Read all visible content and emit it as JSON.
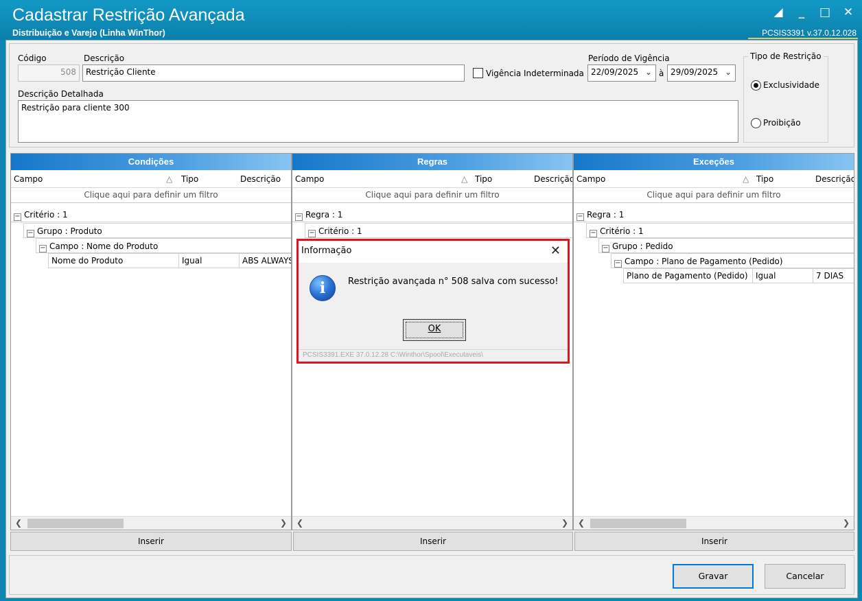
{
  "window": {
    "title": "Cadastrar Restrição Avançada",
    "subtitle": "Distribuição e Varejo (Linha WinThor)",
    "version": "PCSIS3391  v.37.0.12.028"
  },
  "form": {
    "codigo_label": "Código",
    "codigo_value": "508",
    "descricao_label": "Descrição",
    "descricao_value": "Restrição Cliente",
    "vigencia_indeterminada_label": "Vigência Indeterminada",
    "periodo_label": "Período de Vigência",
    "data_inicio": "22/09/2025",
    "separador": "à",
    "data_fim": "29/09/2025",
    "descricao_detalhada_label": "Descrição Detalhada",
    "descricao_detalhada_value": "Restrição para cliente 300",
    "tipo_restricao_title": "Tipo de Restrição",
    "opt_exclusividade": "Exclusividade",
    "opt_proibicao": "Proibição"
  },
  "panels": {
    "condicoes": {
      "header": "Condições",
      "col_campo": "Campo",
      "col_tipo": "Tipo",
      "col_descricao": "Descrição",
      "filter": "Clique aqui para definir um filtro",
      "row1": "Critério : 1",
      "row2": "Grupo : Produto",
      "row3": "Campo : Nome do Produto",
      "cell_campo": "Nome do Produto",
      "cell_tipo": "Igual",
      "cell_desc": "ABS ALWAYS",
      "insert": "Inserir"
    },
    "regras": {
      "header": "Regras",
      "col_campo": "Campo",
      "col_tipo": "Tipo",
      "col_descricao": "Descrição",
      "filter": "Clique aqui para definir um filtro",
      "row1": "Regra : 1",
      "row2": "Critério : 1",
      "insert": "Inserir"
    },
    "excecoes": {
      "header": "Exceções",
      "col_campo": "Campo",
      "col_tipo": "Tipo",
      "col_descricao": "Descrição",
      "filter": "Clique aqui para definir um filtro",
      "row1": "Regra : 1",
      "row2": "Critério : 1",
      "row3": "Grupo : Pedido",
      "row4": "Campo : Plano de Pagamento (Pedido)",
      "cell_campo": "Plano de Pagamento (Pedido)",
      "cell_tipo": "Igual",
      "cell_desc": "7 DIAS",
      "insert": "Inserir"
    }
  },
  "buttons": {
    "gravar": "Gravar",
    "cancelar": "Cancelar"
  },
  "dialog": {
    "title": "Informação",
    "message": "Restrição avançada n° 508 salva com sucesso!",
    "ok": "OK",
    "footer": "PCSIS3391.EXE 37.0.12.28 C:\\Winthor\\Spool\\Executaveis\\"
  }
}
